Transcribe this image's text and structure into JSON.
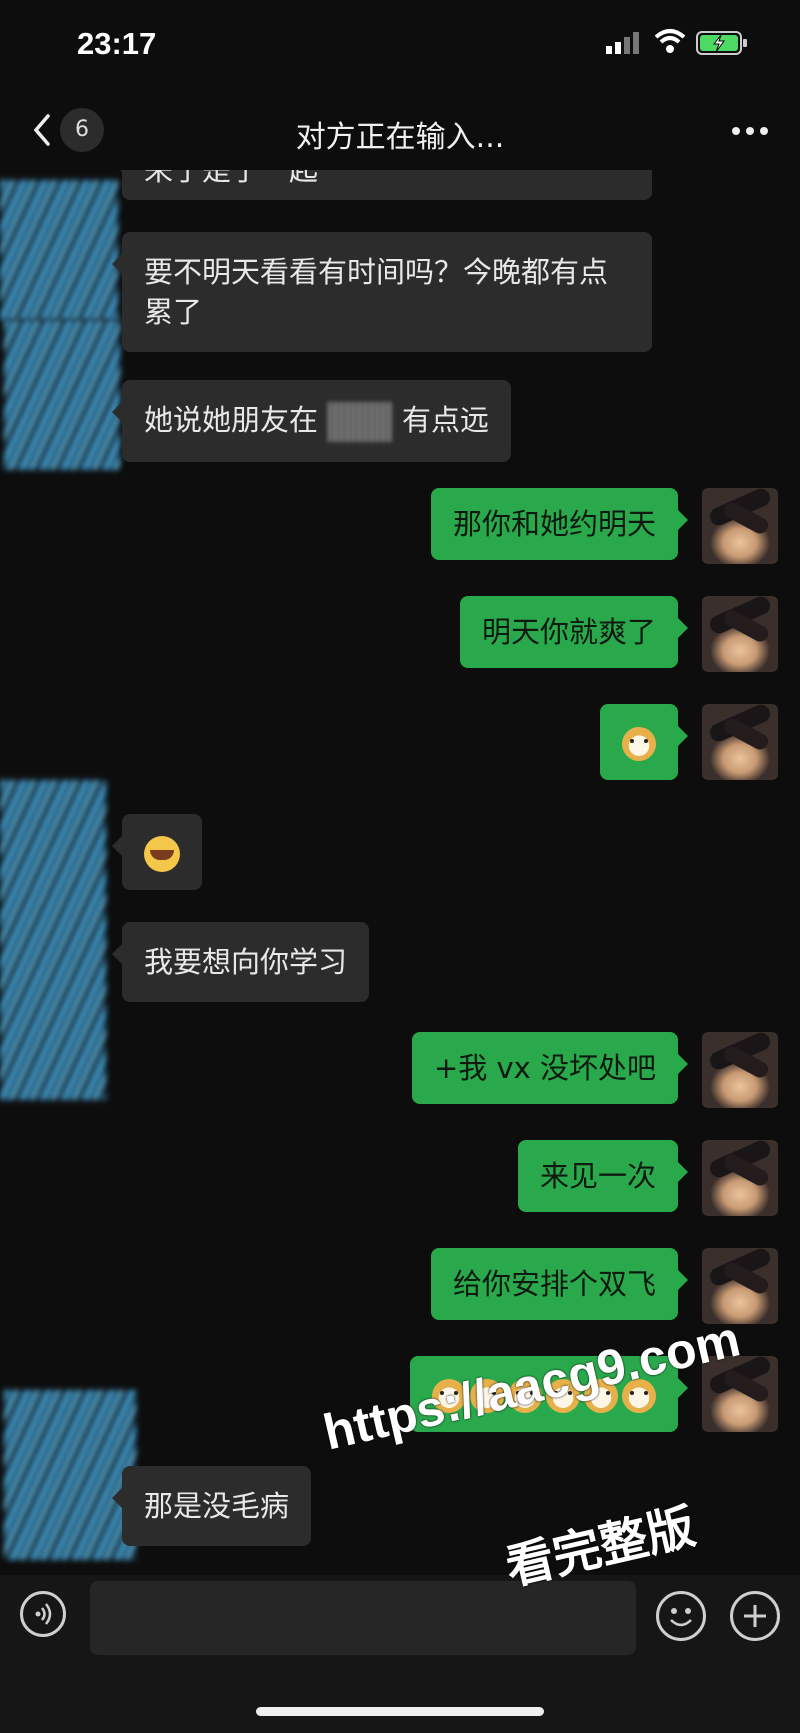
{
  "status": {
    "time": "23:17"
  },
  "nav": {
    "unread_count": "6",
    "title": "对方正在输入..."
  },
  "messages": [
    {
      "side": "in",
      "text": "来了是了一起"
    },
    {
      "side": "in",
      "text": "要不明天看看有时间吗？今晚都有点累了"
    },
    {
      "side": "in",
      "text_before": "她说她朋友在",
      "text_after": "有点远"
    },
    {
      "side": "out",
      "text": "那你和她约明天"
    },
    {
      "side": "out",
      "text": "明天你就爽了"
    },
    {
      "side": "out",
      "emoji": "doge",
      "count": 1
    },
    {
      "side": "in",
      "emoji": "cry-laugh",
      "count": 1
    },
    {
      "side": "in",
      "text": "我要想向你学习"
    },
    {
      "side": "out",
      "text": "+我 vx 没坏处吧"
    },
    {
      "side": "out",
      "text": "来见一次"
    },
    {
      "side": "out",
      "text": "给你安排个双飞"
    },
    {
      "side": "out",
      "emoji": "doge",
      "count": 6
    },
    {
      "side": "in",
      "text": "那是没毛病"
    }
  ],
  "watermark": {
    "line1": "https://aacg9.com",
    "line2": "看完整版"
  },
  "colors": {
    "out_bubble": "#2aa94c",
    "in_bubble": "#2c2c2c",
    "background": "#0d0d0d"
  },
  "icons": [
    "voice-icon",
    "emoji-icon",
    "plus-icon",
    "back-icon",
    "more-icon",
    "signal-icon",
    "wifi-icon",
    "battery-icon"
  ]
}
